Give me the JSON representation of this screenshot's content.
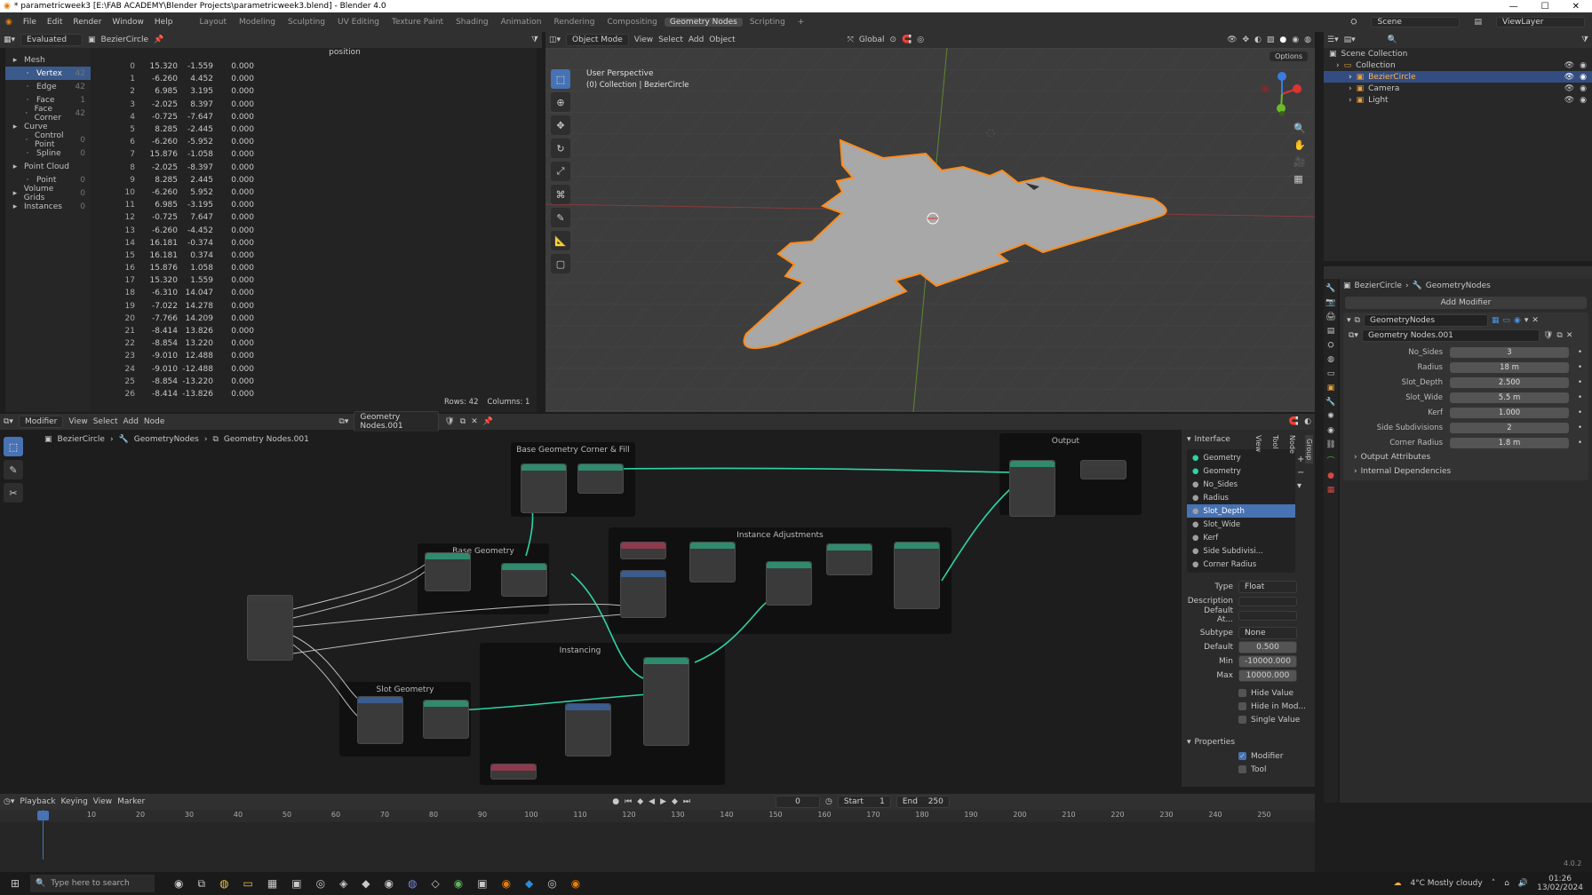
{
  "window": {
    "title": "* parametricweek3 [E:\\FAB ACADEMY\\Blender Projects\\parametricweek3.blend] - Blender 4.0"
  },
  "menu": {
    "items": [
      "File",
      "Edit",
      "Render",
      "Window",
      "Help"
    ]
  },
  "workspaces": [
    "Layout",
    "Modeling",
    "Sculpting",
    "UV Editing",
    "Texture Paint",
    "Shading",
    "Animation",
    "Rendering",
    "Compositing",
    "Geometry Nodes",
    "Scripting"
  ],
  "workspace_add": "+",
  "scene": {
    "name": "Scene",
    "view_layer": "ViewLayer"
  },
  "spreadsheet": {
    "mode": "Evaluated",
    "object": "BezierCircle",
    "column_header": "position",
    "tree": [
      {
        "label": "Mesh",
        "count": "",
        "level": 0,
        "icon": "mesh-icon"
      },
      {
        "label": "Vertex",
        "count": "42",
        "level": 1,
        "selected": true,
        "icon": "vertex-icon"
      },
      {
        "label": "Edge",
        "count": "42",
        "level": 1,
        "icon": "edge-icon"
      },
      {
        "label": "Face",
        "count": "1",
        "level": 1,
        "icon": "face-icon"
      },
      {
        "label": "Face Corner",
        "count": "42",
        "level": 1,
        "icon": "face-corner-icon"
      },
      {
        "label": "Curve",
        "count": "",
        "level": 0,
        "icon": "curve-icon"
      },
      {
        "label": "Control Point",
        "count": "0",
        "level": 1,
        "icon": "control-point-icon"
      },
      {
        "label": "Spline",
        "count": "0",
        "level": 1,
        "icon": "spline-icon"
      },
      {
        "label": "Point Cloud",
        "count": "",
        "level": 0,
        "icon": "point-cloud-icon"
      },
      {
        "label": "Point",
        "count": "0",
        "level": 1,
        "icon": "point-icon"
      },
      {
        "label": "Volume Grids",
        "count": "0",
        "level": 0,
        "icon": "volume-icon"
      },
      {
        "label": "Instances",
        "count": "0",
        "level": 0,
        "icon": "instances-icon"
      }
    ],
    "rows": [
      [
        "0",
        "15.320",
        "-1.559",
        "0.000"
      ],
      [
        "1",
        "-6.260",
        "4.452",
        "0.000"
      ],
      [
        "2",
        "6.985",
        "3.195",
        "0.000"
      ],
      [
        "3",
        "-2.025",
        "8.397",
        "0.000"
      ],
      [
        "4",
        "-0.725",
        "-7.647",
        "0.000"
      ],
      [
        "5",
        "8.285",
        "-2.445",
        "0.000"
      ],
      [
        "6",
        "-6.260",
        "-5.952",
        "0.000"
      ],
      [
        "7",
        "15.876",
        "-1.058",
        "0.000"
      ],
      [
        "8",
        "-2.025",
        "-8.397",
        "0.000"
      ],
      [
        "9",
        "8.285",
        "2.445",
        "0.000"
      ],
      [
        "10",
        "-6.260",
        "5.952",
        "0.000"
      ],
      [
        "11",
        "6.985",
        "-3.195",
        "0.000"
      ],
      [
        "12",
        "-0.725",
        "7.647",
        "0.000"
      ],
      [
        "13",
        "-6.260",
        "-4.452",
        "0.000"
      ],
      [
        "14",
        "16.181",
        "-0.374",
        "0.000"
      ],
      [
        "15",
        "16.181",
        "0.374",
        "0.000"
      ],
      [
        "16",
        "15.876",
        "1.058",
        "0.000"
      ],
      [
        "17",
        "15.320",
        "1.559",
        "0.000"
      ],
      [
        "18",
        "-6.310",
        "14.047",
        "0.000"
      ],
      [
        "19",
        "-7.022",
        "14.278",
        "0.000"
      ],
      [
        "20",
        "-7.766",
        "14.209",
        "0.000"
      ],
      [
        "21",
        "-8.414",
        "13.826",
        "0.000"
      ],
      [
        "22",
        "-8.854",
        "13.220",
        "0.000"
      ],
      [
        "23",
        "-9.010",
        "12.488",
        "0.000"
      ],
      [
        "24",
        "-9.010",
        "-12.488",
        "0.000"
      ],
      [
        "25",
        "-8.854",
        "-13.220",
        "0.000"
      ],
      [
        "26",
        "-8.414",
        "-13.826",
        "0.000"
      ]
    ],
    "footer": {
      "rows": "Rows: 42",
      "columns": "Columns: 1"
    }
  },
  "viewport": {
    "mode": "Object Mode",
    "menus": [
      "View",
      "Select",
      "Add",
      "Object"
    ],
    "orientation": "Global",
    "options": "Options",
    "perspective": "User Perspective",
    "collection_path": "(0) Collection | BezierCircle"
  },
  "outliner": {
    "root": "Scene Collection",
    "items": [
      {
        "label": "Collection",
        "level": 1
      },
      {
        "label": "BezierCircle",
        "level": 2,
        "selected": true
      },
      {
        "label": "Camera",
        "level": 2
      },
      {
        "label": "Light",
        "level": 2
      }
    ]
  },
  "properties": {
    "breadcrumb": [
      "BezierCircle",
      "GeometryNodes"
    ],
    "add_modifier": "Add Modifier",
    "modifier_name": "GeometryNodes",
    "node_group": "Geometry Nodes.001",
    "inputs": [
      {
        "label": "No_Sides",
        "value": "3"
      },
      {
        "label": "Radius",
        "value": "18 m"
      },
      {
        "label": "Slot_Depth",
        "value": "2.500"
      },
      {
        "label": "Slot_Wide",
        "value": "5.5 m"
      },
      {
        "label": "Kerf",
        "value": "1.000"
      },
      {
        "label": "Side Subdivisions",
        "value": "2"
      },
      {
        "label": "Corner Radius",
        "value": "1.8 m"
      }
    ],
    "panels": [
      "Output Attributes",
      "Internal Dependencies"
    ]
  },
  "node_editor": {
    "editor": "Modifier",
    "menus": [
      "View",
      "Select",
      "Add",
      "Node"
    ],
    "group": "Geometry Nodes.001",
    "breadcrumb": [
      "BezierCircle",
      "GeometryNodes",
      "Geometry Nodes.001"
    ],
    "frames": [
      "Base Geometry Corner & Fill",
      "Instance Adjustments",
      "Base Geometry",
      "Output",
      "Instancing",
      "Slot Geometry"
    ]
  },
  "interface_panel": {
    "title": "Interface",
    "sockets": [
      "Geometry",
      "Geometry",
      "No_Sides",
      "Radius",
      "Slot_Depth",
      "Slot_Wide",
      "Kerf",
      "Side Subdivisi...",
      "Corner Radius"
    ],
    "selected_index": 4,
    "type_label": "Type",
    "type": "Float",
    "description_label": "Description",
    "default_attr_label": "Default At...",
    "subtype_label": "Subtype",
    "subtype": "None",
    "default_label": "Default",
    "default": "0.500",
    "min_label": "Min",
    "min": "-10000.000",
    "max_label": "Max",
    "max": "10000.000",
    "checks": [
      "Hide Value",
      "Hide in Mod...",
      "Single Value"
    ],
    "properties_title": "Properties",
    "props": [
      {
        "label": "Modifier",
        "checked": true
      },
      {
        "label": "Tool",
        "checked": false
      }
    ],
    "side_tabs": [
      "Group",
      "Node",
      "Tool",
      "View"
    ]
  },
  "timeline": {
    "menus": [
      "Playback",
      "Keying",
      "View",
      "Marker"
    ],
    "current_frame": "0",
    "start_label": "Start",
    "start": "1",
    "end_label": "End",
    "end": "250",
    "ticks": [
      "0",
      "10",
      "20",
      "30",
      "40",
      "50",
      "60",
      "70",
      "80",
      "90",
      "100",
      "110",
      "120",
      "130",
      "140",
      "150",
      "160",
      "170",
      "180",
      "190",
      "200",
      "210",
      "220",
      "230",
      "240",
      "250"
    ]
  },
  "taskbar": {
    "search_placeholder": "Type here to search",
    "weather": "4°C  Mostly cloudy",
    "time": "01:26",
    "date": "13/02/2024"
  },
  "version": "4.0.2",
  "colors": {
    "accent": "#4772b3",
    "selection": "#ff8c1a",
    "node_wire": "#2ed3a6"
  }
}
